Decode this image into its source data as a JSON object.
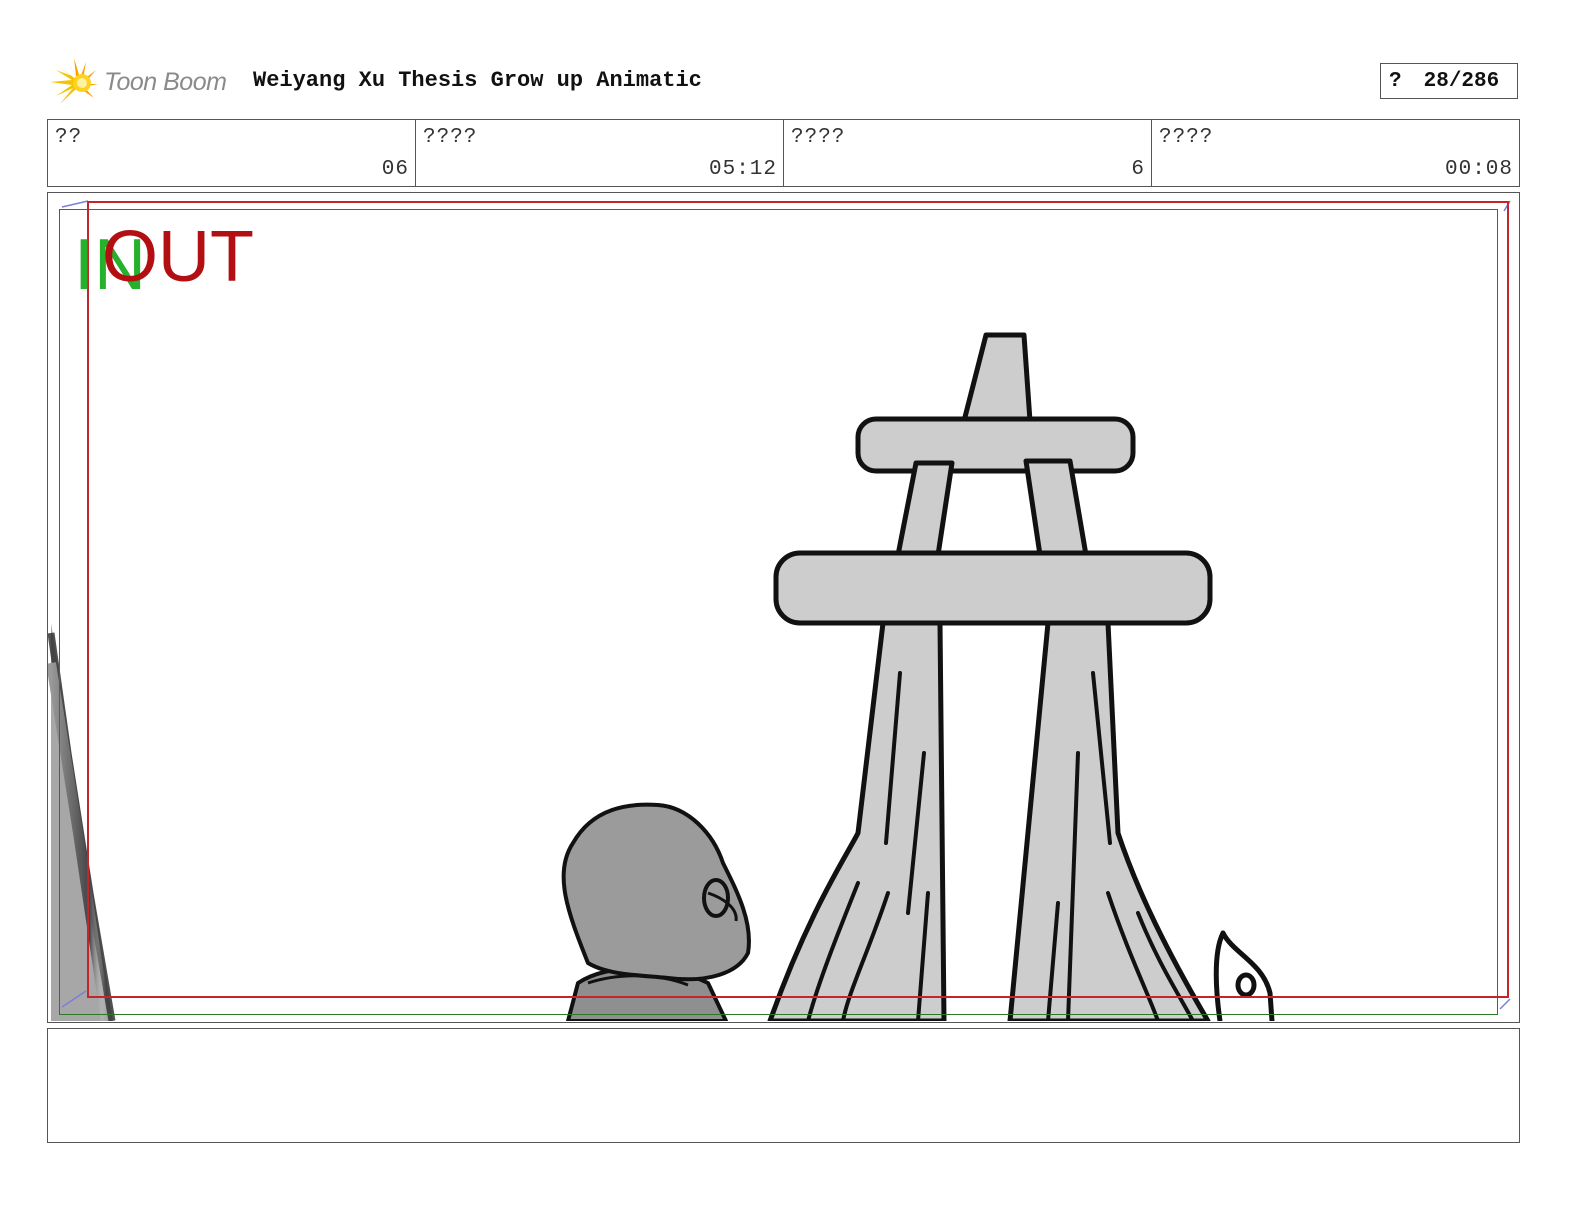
{
  "header": {
    "logo_text": "Toon Boom",
    "project_title": "Weiyang Xu Thesis Grow up Animatic",
    "page_mark": "?",
    "page_number": "28/286"
  },
  "info": [
    {
      "label": "??",
      "value": "06"
    },
    {
      "label": "????",
      "value": "05:12"
    },
    {
      "label": "????",
      "value": "6"
    },
    {
      "label": "????",
      "value": "00:08"
    }
  ],
  "panel": {
    "in_label": "IN",
    "out_label": "OUT",
    "in_color": "#25b12b",
    "out_color": "#b30e12"
  },
  "notes": {
    "text": ""
  }
}
